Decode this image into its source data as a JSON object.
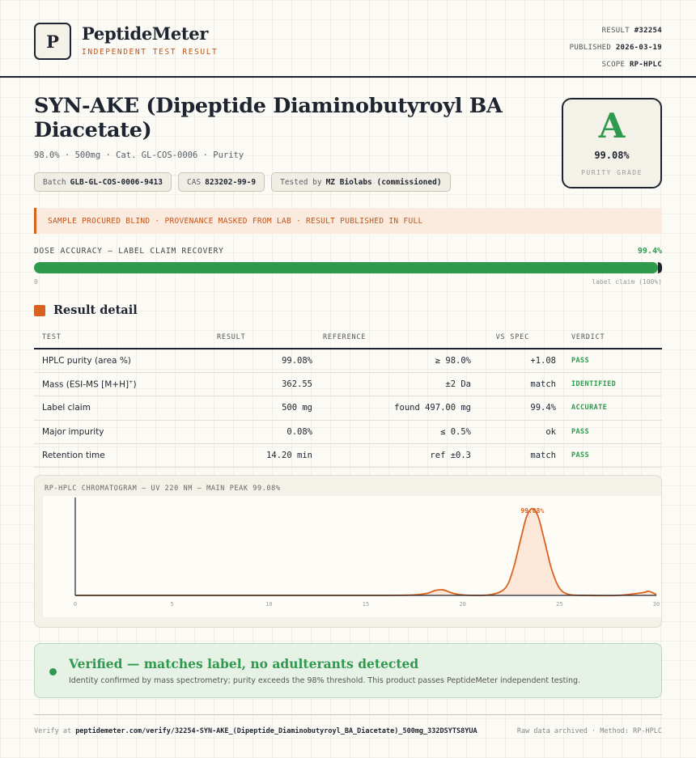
{
  "header": {
    "logo_letter": "P",
    "brand": "PeptideMeter",
    "tagline": "INDEPENDENT TEST RESULT",
    "result_label": "RESULT",
    "result_value": "#32254",
    "published_label": "PUBLISHED",
    "published_value": "2026-03-19",
    "scope_label": "SCOPE",
    "scope_value": "RP-HPLC"
  },
  "product": {
    "title": "SYN-AKE (Dipeptide Diaminobutyroyl BA Diacetate)",
    "subtitle": "98.0% · 500mg · Cat. GL-COS-0006 · Purity",
    "batch_label": "Batch",
    "batch_value": "GLB-GL-COS-0006-9413",
    "cas_label": "CAS",
    "cas_value": "823202-99-9",
    "tested_label": "Tested by",
    "tested_value": "MZ Biolabs (commissioned)"
  },
  "grade": {
    "letter": "A",
    "value": "99.08%",
    "label": "PURITY GRADE"
  },
  "banner": "SAMPLE PROCURED BLIND · PROVENANCE MASKED FROM LAB · RESULT PUBLISHED IN FULL",
  "dose": {
    "label": "DOSE ACCURACY — LABEL CLAIM RECOVERY",
    "value_text": "99.4%",
    "fraction": 0.994,
    "zero_label": "0",
    "claim_label": "label claim (100%)"
  },
  "section_title": "Result detail",
  "table": {
    "headers": [
      "TEST",
      "RESULT",
      "REFERENCE",
      "VS SPEC",
      "VERDICT"
    ],
    "rows": [
      {
        "test": "HPLC purity (area %)",
        "result": "99.08%",
        "reference": "≥ 98.0%",
        "vs": "+1.08",
        "verdict": "PASS"
      },
      {
        "test": "Mass (ESI-MS [M+H]",
        "test_sup": "+",
        "test_tail": ")",
        "result": "362.55",
        "reference": "±2 Da",
        "vs": "match",
        "verdict": "IDENTIFIED"
      },
      {
        "test": "Label claim",
        "result": "500 mg",
        "reference": "found 497.00 mg",
        "vs": "99.4%",
        "verdict": "ACCURATE"
      },
      {
        "test": "Major impurity",
        "result": "0.08%",
        "reference": "≤ 0.5%",
        "vs": "ok",
        "verdict": "PASS"
      },
      {
        "test": "Retention time",
        "result": "14.20 min",
        "reference": "ref ±0.3",
        "vs": "match",
        "verdict": "PASS"
      }
    ]
  },
  "chart_data": {
    "type": "line",
    "title": "RP-HPLC CHROMATOGRAM — UV 220 NM — MAIN PEAK 99.08%",
    "x_ticks": [
      "0",
      "5",
      "10",
      "15",
      "20",
      "25",
      "30"
    ],
    "x_range": [
      0,
      30
    ],
    "y_range": [
      0,
      1
    ],
    "peak_label": "99.08%",
    "peak_label_x": 23.6,
    "series": [
      {
        "x": [
          0,
          4,
          8,
          12,
          16,
          17.5,
          18.2,
          18.6,
          19.0,
          19.4,
          19.8,
          20.5,
          21.5,
          22.2,
          22.6,
          23.0,
          23.3,
          23.6,
          23.9,
          24.2,
          24.6,
          25.0,
          25.5,
          26.5,
          28,
          29.3,
          29.6,
          30
        ],
        "y": [
          0.0,
          0.0,
          0.0,
          0.0,
          0.0,
          0.005,
          0.025,
          0.055,
          0.06,
          0.03,
          0.01,
          0.0,
          0.01,
          0.08,
          0.28,
          0.62,
          0.86,
          0.95,
          0.86,
          0.62,
          0.28,
          0.08,
          0.01,
          0.0,
          0.0,
          0.03,
          0.045,
          0.01
        ]
      }
    ],
    "colors": {
      "line": "#d9621e",
      "fill": "#fbe3d2",
      "axis": "#1e2430"
    }
  },
  "verified": {
    "title": "Verified — matches label, no adulterants detected",
    "text": "Identity confirmed by mass spectrometry; purity exceeds the 98% threshold. This product passes PeptideMeter independent testing."
  },
  "footer": {
    "verify_prefix": "Verify at",
    "verify_url": "peptidemeter.com/verify/32254-SYN-AKE_(Dipeptide_Diaminobutyroyl_BA_Diacetate)_500mg_332DSYTS8YUA",
    "right": "Raw data archived · Method: RP-HPLC"
  },
  "colors": {
    "accent_orange": "#d9621e",
    "pass_green": "#2f9a4d",
    "ink": "#1e2430"
  }
}
